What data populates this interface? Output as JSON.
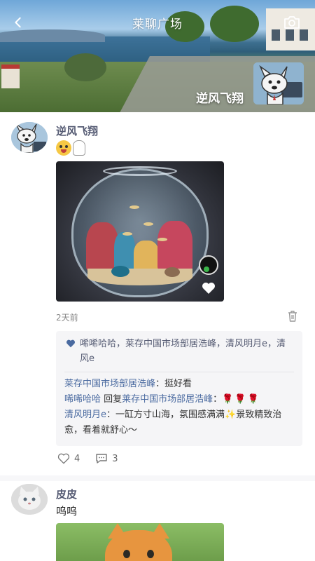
{
  "header": {
    "title": "莱聊广场",
    "cover_user_name": "逆风飞翔",
    "back_icon": "chevron-left-icon",
    "camera_icon": "camera-icon"
  },
  "posts": [
    {
      "username": "逆风飞翔",
      "content_emojis": [
        "grinning-face-emoji",
        "tongue-hand-emoji"
      ],
      "photo_alt": "fish-bowl-photo",
      "time": "2天前",
      "likes_text": "唏唏哈哈，莱存中国市场部居浩峰，清风明月e，清风e",
      "comments": [
        {
          "author": "莱存中国市场部居浩峰",
          "text": "挺好看"
        },
        {
          "author": "唏唏哈哈",
          "reply_word": " 回复",
          "reply_to": "莱存中国市场部居浩峰",
          "text": "",
          "roses": "🌹🌹🌹"
        },
        {
          "author": "清风明月e",
          "text": "一缸方寸山海，氛围感满满✨景致精致治愈，看着就舒心～"
        }
      ],
      "like_count": "4",
      "comment_count": "3"
    },
    {
      "username": "皮皮",
      "content": "呜呜",
      "photo_alt": "cat-photo"
    }
  ],
  "colors": {
    "name_color": "#555b73",
    "comment_author_color": "#4a6aa0",
    "comment_box_bg": "#f5f5f7"
  }
}
